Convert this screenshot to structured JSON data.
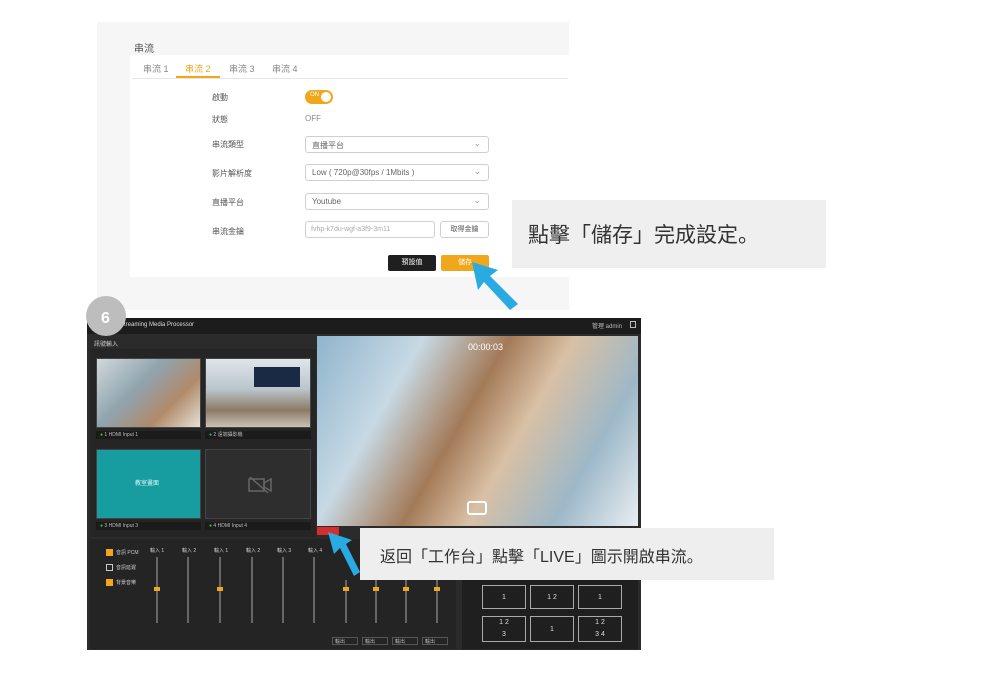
{
  "settings": {
    "section_title": "串流",
    "tabs": [
      "串流 1",
      "串流 2",
      "串流 3",
      "串流 4"
    ],
    "active_tab": 1,
    "fields": {
      "enable_label": "啟動",
      "enable_value": "ON",
      "status_label": "狀態",
      "status_value": "OFF",
      "stream_type_label": "串流類型",
      "stream_type_value": "直播平台",
      "video_quality_label": "影片解析度",
      "video_quality_value": "Low ( 720p@30fps / 1Mbits )",
      "platform_label": "直播平台",
      "platform_value": "Youtube",
      "key_label": "串流金鑰",
      "key_value": "fvhp-k7du-wgf-a3f9-3m11",
      "get_key_label": "取得金鑰"
    },
    "preview_label": "預設值",
    "save_label": "儲存"
  },
  "callouts": {
    "step1": "點擊「儲存」完成設定。",
    "step2": "返回「工作台」點擊「LIVE」圖示開啟串流。"
  },
  "app": {
    "step_number": "6",
    "title": "Streaming Media Processor",
    "user_label": "管理 admin",
    "sources_label": "訊號輸入",
    "timecode": "00:00:03",
    "sources": [
      {
        "index": "1",
        "name": "HDMI Input 1"
      },
      {
        "index": "2",
        "name": "遠端攝影機"
      },
      {
        "index": "3",
        "name": "HDMI Input 3"
      },
      {
        "index": "4",
        "name": "HDMI Input 4"
      }
    ],
    "thumb3_text": "教室畫面",
    "checkboxes": [
      "音訊 PCM",
      "音訊延遲",
      "背景音樂"
    ],
    "faders": [
      "輸入 1",
      "輸入 2",
      "輸入 1",
      "輸入 2",
      "輸入 3",
      "輸入 4"
    ],
    "layout_numbers": {
      "row1": [
        "1",
        "1",
        "2",
        "1"
      ],
      "row2": [
        "1",
        "2",
        "3",
        "1",
        "1",
        "2",
        "3",
        "4"
      ]
    },
    "output_selects": [
      "輸出",
      "輸出",
      "輸出",
      "輸出"
    ]
  }
}
